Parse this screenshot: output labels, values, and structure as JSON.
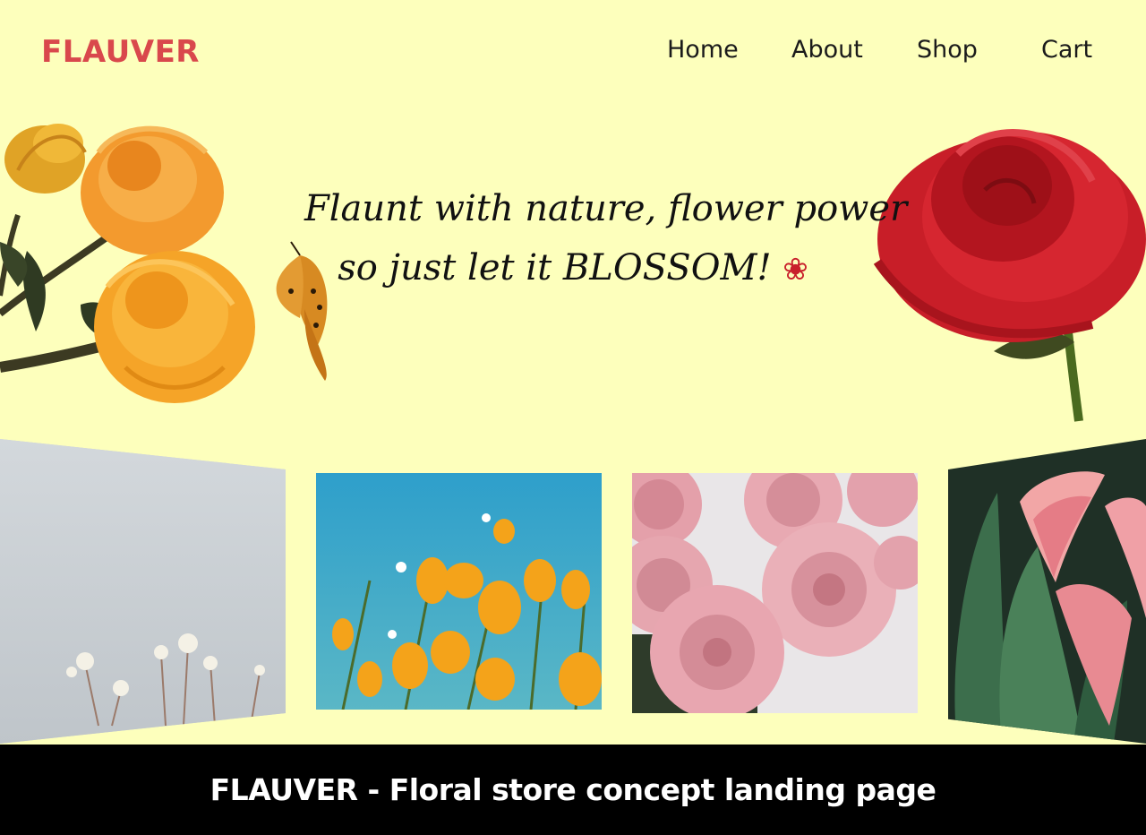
{
  "brand": {
    "logo_text": "FLAUVER",
    "logo_color": "#D9484C",
    "background": "#FDFFBC"
  },
  "nav": {
    "items": [
      {
        "label": "Home"
      },
      {
        "label": "About"
      },
      {
        "label": "Shop"
      },
      {
        "label": "Cart"
      }
    ]
  },
  "hero": {
    "tagline_line1": "Flaunt with nature, flower power",
    "tagline_line2": "so just let it BLOSSOM!",
    "tagline_icon": "rose-bud-icon",
    "left_image": "orange-flowers-with-butterfly",
    "right_image": "red-rose"
  },
  "gallery": {
    "photos": [
      {
        "name": "white-wildflowers"
      },
      {
        "name": "yellow-poppies"
      },
      {
        "name": "pink-roses"
      },
      {
        "name": "pink-calla-lilies"
      }
    ]
  },
  "footer": {
    "caption": "FLAUVER - Floral store concept landing page"
  }
}
